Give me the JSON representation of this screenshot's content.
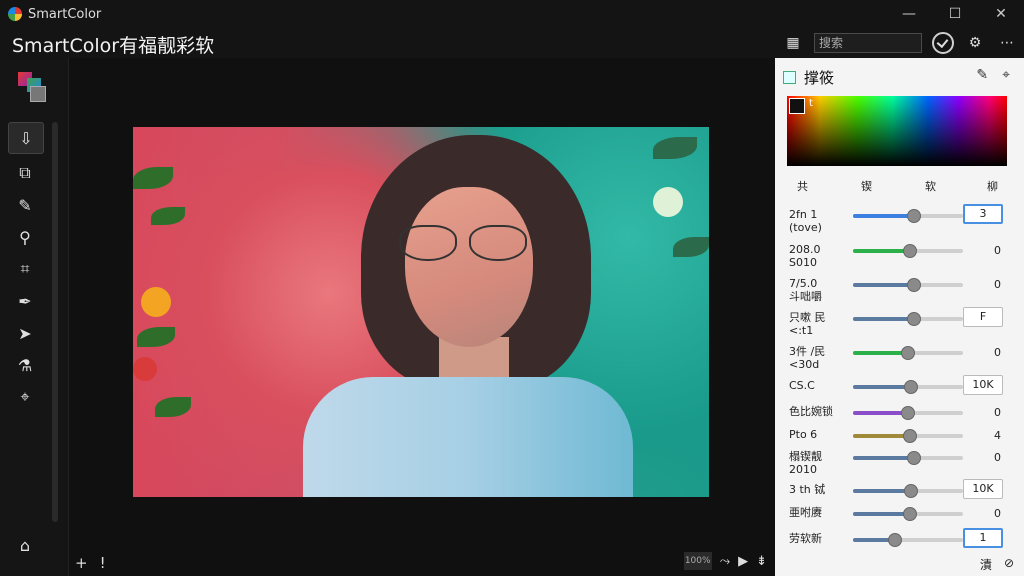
{
  "app": {
    "name": "SmartColor",
    "page_title": "SmartColor有福靓彩软"
  },
  "window": {
    "minimize": "—",
    "maximize": "☐",
    "close": "✕"
  },
  "header": {
    "search_placeholder": "搜索"
  },
  "toolbar": {
    "tools": [
      "import-tool",
      "transform-tool",
      "brush-tool",
      "zoom-tool",
      "crop-tool",
      "pen-tool",
      "pointer-tool",
      "eyedropper-tool",
      "grid-tool"
    ],
    "bottom": "⌂"
  },
  "canvas": {
    "footer_left": [
      "+",
      "!"
    ],
    "zoom": "100%",
    "footer_right": [
      "⤳",
      "▶",
      "⇟"
    ]
  },
  "panel": {
    "title": "撑筱",
    "spectrum_label": "t",
    "tabs": [
      "共",
      "锲",
      "软",
      "柳"
    ],
    "colors": {
      "blue": "#3b7fe0",
      "green": "#2bb04a",
      "steel": "#5a7aa0",
      "purple": "#8a4fc8",
      "olive": "#a08a3a"
    },
    "sliders": [
      {
        "label": "2fn 1\n(tove)",
        "value": "3",
        "level": 0.55,
        "color": "#3b7fe0",
        "box": true,
        "hl": true
      },
      {
        "label": "208.0\nS010",
        "value": "0",
        "level": 0.52,
        "color": "#2bb04a",
        "box": false
      },
      {
        "label": "7/5.0\n斗咄嚼",
        "value": "0",
        "level": 0.55,
        "color": "#5a7aa0",
        "box": false
      },
      {
        "label": "只嗽 民\n<:t1",
        "value": "F",
        "level": 0.55,
        "color": "#5a7aa0",
        "box": true
      },
      {
        "label": "3件 /民\n<30d",
        "value": "0",
        "level": 0.5,
        "color": "#2bb04a",
        "box": false
      },
      {
        "label": "CS.C",
        "value": "10K",
        "level": 0.53,
        "color": "#5a7aa0",
        "box": true
      },
      {
        "label": "色比婉锁",
        "value": "0",
        "level": 0.5,
        "color": "#8a4fc8",
        "box": false
      },
      {
        "label": "Pto 6",
        "value": "4",
        "level": 0.52,
        "color": "#a08a3a",
        "box": false
      },
      {
        "label": "榻锲靓\n2010",
        "value": "0",
        "level": 0.55,
        "color": "#5a7aa0",
        "box": false
      },
      {
        "label": "3 th 铽",
        "value": "10K",
        "level": 0.53,
        "color": "#5a7aa0",
        "box": true
      },
      {
        "label": "亜咐赓",
        "value": "0",
        "level": 0.52,
        "color": "#5a7aa0",
        "box": false
      },
      {
        "label": "劳软新",
        "value": "1",
        "level": 0.38,
        "color": "#5a7aa0",
        "box": true,
        "hl": true
      }
    ],
    "footer": [
      "漬",
      "⊘"
    ]
  }
}
